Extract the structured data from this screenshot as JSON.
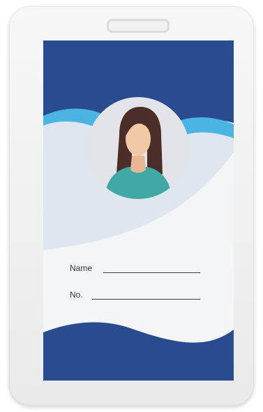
{
  "id_card": {
    "name_label": "Name",
    "number_label": "No."
  },
  "colors": {
    "primary_blue": "#294b8f",
    "light_blue_wave": "#4cb4e2",
    "pale_wave": "#dfe6ef",
    "card_white": "#f4f5f7",
    "avatar_circle": "#e2e4e7",
    "hair": "#4a2e27",
    "skin": "#f2c9a7",
    "shirt": "#41a8a6"
  },
  "icons": {
    "avatar": "woman-avatar-icon"
  }
}
